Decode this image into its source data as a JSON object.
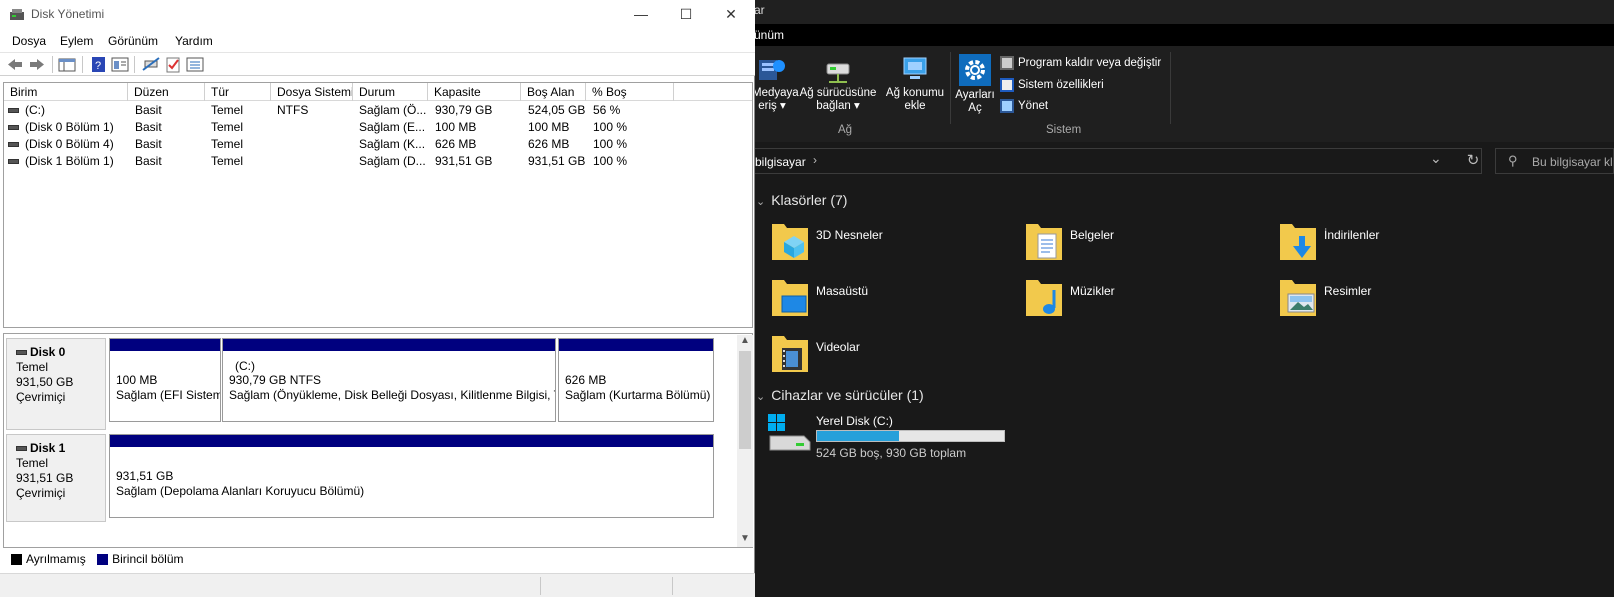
{
  "explorer": {
    "window_title": "ar",
    "tab_label": "ünüm",
    "ribbon": {
      "media_label_1": "Medyaya",
      "media_label_2": "eriş ▾",
      "map_drive_1": "Ağ sürücüsüne",
      "map_drive_2": "bağlan ▾",
      "add_location_1": "Ağ konumu",
      "add_location_2": "ekle",
      "network_group": "Ağ",
      "settings_1": "Ayarları",
      "settings_2": "Aç",
      "uninstall": "Program kaldır veya değiştir",
      "system_props": "Sistem özellikleri",
      "manage": "Yönet",
      "system_group": "Sistem"
    },
    "address": {
      "path": "bilgisayar",
      "chevron": "›",
      "dropdown": "⌄",
      "refresh": "↻"
    },
    "search": {
      "placeholder": "Bu bilgisayar kl"
    },
    "folders_header": "Klasörler (7)",
    "folders": [
      {
        "name": "3D Nesneler",
        "icon": "3d-objects-folder-icon"
      },
      {
        "name": "Belgeler",
        "icon": "documents-folder-icon"
      },
      {
        "name": "İndirilenler",
        "icon": "downloads-folder-icon"
      },
      {
        "name": "Masaüstü",
        "icon": "desktop-folder-icon"
      },
      {
        "name": "Müzikler",
        "icon": "music-folder-icon"
      },
      {
        "name": "Resimler",
        "icon": "pictures-folder-icon"
      },
      {
        "name": "Videolar",
        "icon": "videos-folder-icon"
      }
    ],
    "devices_header": "Cihazlar ve sürücüler (1)",
    "drive": {
      "name": "Yerel Disk (C:)",
      "info": "524 GB boş, 930 GB toplam",
      "used_fraction": 0.437
    },
    "colors": {
      "bg": "#191919",
      "accent": "#26a0da",
      "folder": "#f2c94c"
    }
  },
  "disk_management": {
    "title": "Disk Yönetimi",
    "window_controls": {
      "minimize": "—",
      "maximize": "☐",
      "close": "✕"
    },
    "menu": [
      "Dosya",
      "Eylem",
      "Görünüm",
      "Yardım"
    ],
    "columns": [
      "Birim",
      "Düzen",
      "Tür",
      "Dosya Sistemi",
      "Durum",
      "Kapasite",
      "Boş Alan",
      "% Boş"
    ],
    "volumes": [
      {
        "name": "(C:)",
        "layout": "Basit",
        "type": "Temel",
        "fs": "NTFS",
        "status": "Sağlam (Ö...",
        "capacity": "930,79 GB",
        "free": "524,05 GB",
        "pct": "56 %"
      },
      {
        "name": "(Disk 0 Bölüm 1)",
        "layout": "Basit",
        "type": "Temel",
        "fs": "",
        "status": "Sağlam (E...",
        "capacity": "100 MB",
        "free": "100 MB",
        "pct": "100 %"
      },
      {
        "name": "(Disk 0 Bölüm 4)",
        "layout": "Basit",
        "type": "Temel",
        "fs": "",
        "status": "Sağlam (K...",
        "capacity": "626 MB",
        "free": "626 MB",
        "pct": "100 %"
      },
      {
        "name": "(Disk 1 Bölüm 1)",
        "layout": "Basit",
        "type": "Temel",
        "fs": "",
        "status": "Sağlam (D...",
        "capacity": "931,51 GB",
        "free": "931,51 GB",
        "pct": "100 %"
      }
    ],
    "disks": [
      {
        "name": "Disk 0",
        "type": "Temel",
        "size": "931,50 GB",
        "state": "Çevrimiçi",
        "partitions": [
          {
            "title": "",
            "size": "100 MB",
            "status": "Sağlam (EFI Sistem"
          },
          {
            "title": "(C:)",
            "size": "930,79 GB NTFS",
            "status": "Sağlam (Önyükleme, Disk Belleği Dosyası, Kilitlenme Bilgisi, Ter"
          },
          {
            "title": "",
            "size": "626 MB",
            "status": "Sağlam (Kurtarma Bölümü)"
          }
        ]
      },
      {
        "name": "Disk 1",
        "type": "Temel",
        "size": "931,51 GB",
        "state": "Çevrimiçi",
        "partitions": [
          {
            "title": "",
            "size": "931,51 GB",
            "status": "Sağlam (Depolama Alanları Koruyucu Bölümü)"
          }
        ]
      }
    ],
    "legend": {
      "unallocated": "Ayrılmamış",
      "primary": "Birincil bölüm"
    },
    "colors": {
      "primary_partition": "#00007f",
      "unallocated": "#000000"
    }
  }
}
